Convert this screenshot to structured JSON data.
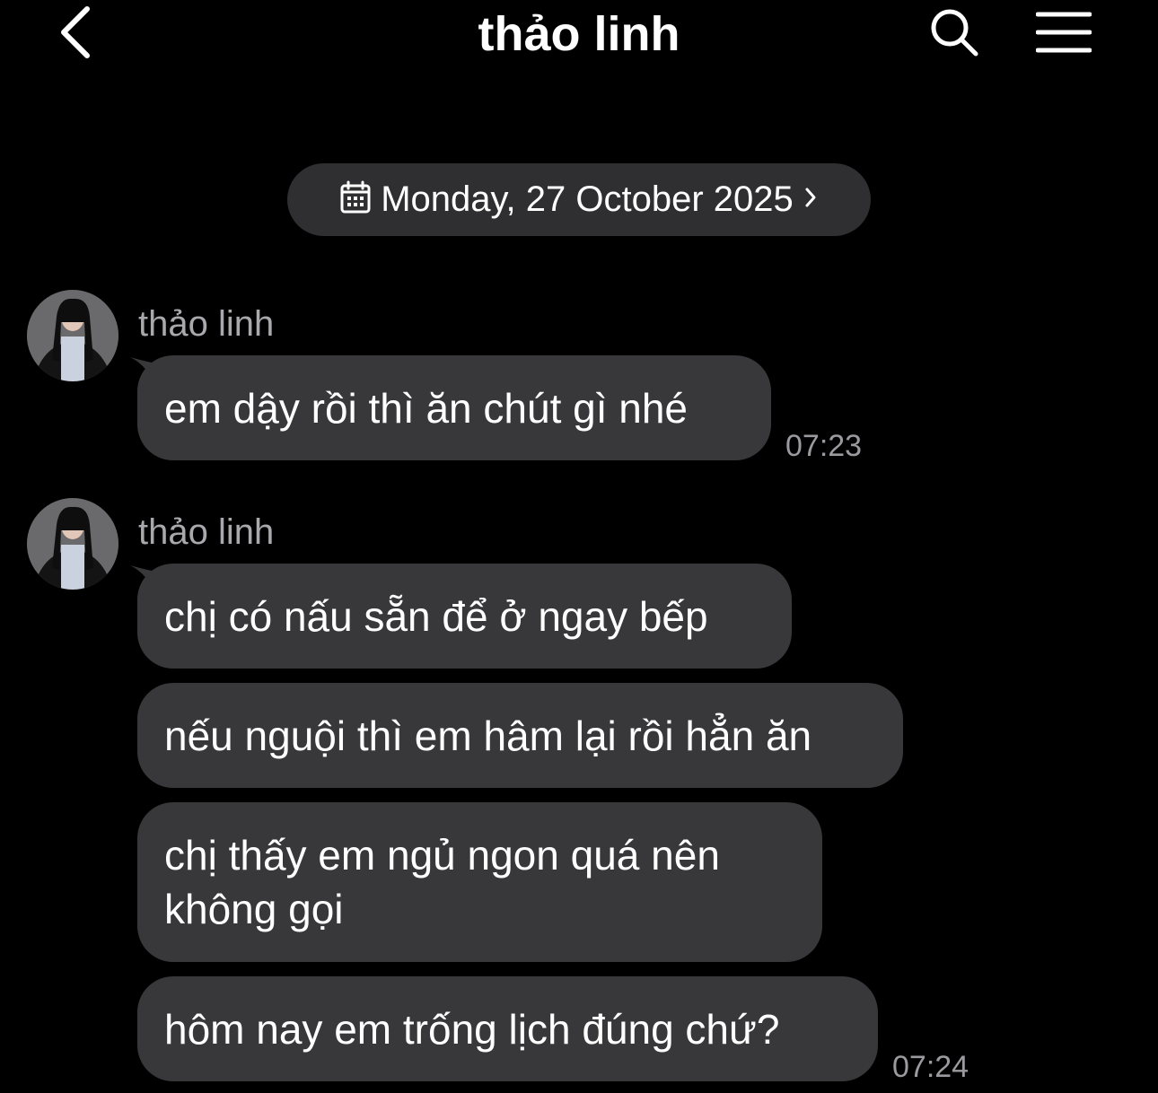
{
  "header": {
    "title": "thảo linh",
    "back_icon": "chevron-left-icon",
    "search_icon": "search-icon",
    "menu_icon": "hamburger-menu-icon"
  },
  "date_pill": {
    "text": "Monday, 27 October 2025",
    "icon": "calendar-icon",
    "trailing_icon": "chevron-right-icon"
  },
  "groups": [
    {
      "sender": "thảo linh",
      "messages": [
        {
          "text": "em dậy rồi thì ăn chút gì nhé",
          "time": "07:23"
        }
      ]
    },
    {
      "sender": "thảo linh",
      "messages": [
        {
          "text": "chị có nấu sẵn để ở ngay bếp"
        },
        {
          "text": "nếu nguội thì em hâm lại rồi hẳn ăn"
        },
        {
          "text": "chị thấy em ngủ ngon quá nên không gọi"
        },
        {
          "text": "hôm nay em trống lịch đúng chứ?",
          "time": "07:24"
        }
      ]
    }
  ],
  "colors": {
    "background": "#000000",
    "bubble": "#38383a",
    "date_pill": "#2f2f31",
    "sender_text": "#a8a8ad",
    "time_text": "#9a9a9f"
  }
}
